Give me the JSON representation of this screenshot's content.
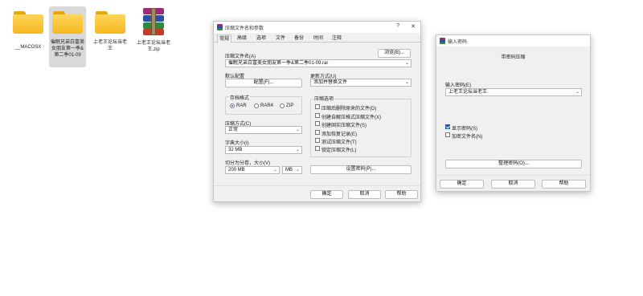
{
  "desktop": {
    "icons": [
      {
        "label_1": "__MACOSX",
        "label_2": ""
      },
      {
        "label_1": "催眠兄弟白富美",
        "label_2": "女朋友第一季&",
        "label_3": "第二季01-09"
      },
      {
        "label_1": "上老王论坛当老",
        "label_2": "王"
      },
      {
        "label_1": "上老王论坛当老",
        "label_2": "王.zip"
      }
    ]
  },
  "archive_dialog": {
    "title": "压缩文件名和参数",
    "help_glyph": "?",
    "close_glyph": "✕",
    "tabs": [
      "常规",
      "高级",
      "选项",
      "文件",
      "备份",
      "时间",
      "注释"
    ],
    "archive_name_label": "压缩文件名(A)",
    "browse_button": "浏览(B)...",
    "archive_name_value": "催眠兄弟白富美女朋友第一季&第二季01-09.rar",
    "default_profile_label": "默认配置",
    "profile_button": "配置(F)...",
    "update_mode_label": "更新方式(U)",
    "update_mode_value": "添加并替换文件",
    "format_group_label": "存档格式",
    "formats": [
      "RAR",
      "RAR4",
      "ZIP"
    ],
    "options_group_label": "压缩选项",
    "options": [
      "压缩后删除原来的文件(D)",
      "创建自解压格式压缩文件(X)",
      "创建固实压缩文件(S)",
      "添加恢复记录(E)",
      "测试压缩文件(T)",
      "锁定压缩文件(L)"
    ],
    "method_label": "压缩方式(C)",
    "method_value": "正常",
    "dict_label": "字典大小(I)",
    "dict_value": "32 MB",
    "split_label": "切分为分卷，大小(V)",
    "split_value": "200 MB",
    "split_unit": "MB",
    "set_password_button": "设置密码(P)...",
    "ok_button": "确定",
    "cancel_button": "取消",
    "help_button": "帮助"
  },
  "password_dialog": {
    "title": "输入密码",
    "heading": "带密码压缩",
    "password_label": "输入密码(E)",
    "password_value": "上老王论坛当老王",
    "show_password": "显示密码(S)",
    "encrypt_names": "加密文件名(N)",
    "organize_button": "整理密码(O)...",
    "ok_button": "确定",
    "cancel_button": "取消",
    "help_button": "帮助"
  }
}
